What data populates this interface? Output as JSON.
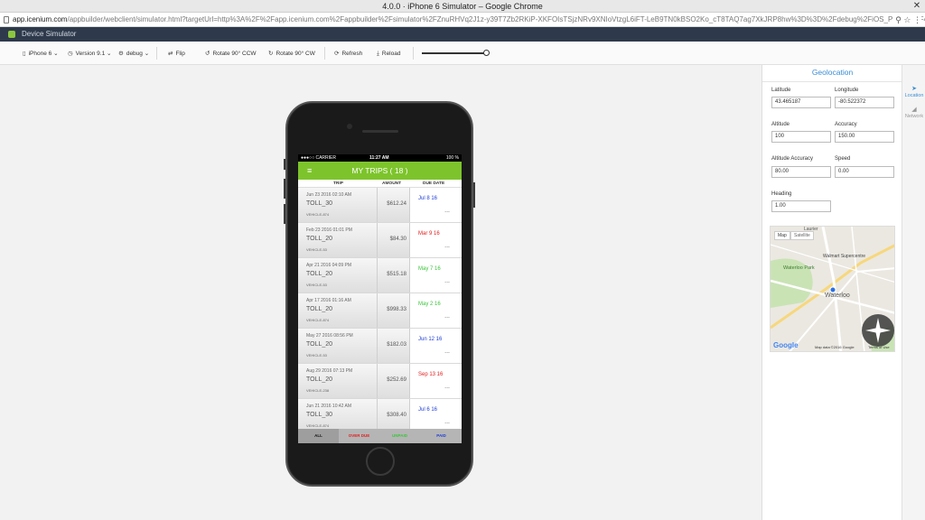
{
  "window": {
    "title": "4.0.0 · iPhone 6 Simulator – Google Chrome"
  },
  "url": {
    "host": "app.icenium.com",
    "path": "/appbuilder/webclient/simulator.html?targetUrl=http%3A%2F%2Fapp.icenium.com%2Fappbuilder%2Fsimulator%2FZnuRHVq2J1z-y39T7Zb2RKiP-XKFOIsTSjzNRv9XNIoVtzgL6iFT-LeB9TN0kBSO2Ko_cT8TAQ7ag7XkJRP8hw%3D%3D%2Fdebug%2FiOS_Phone%2F4.0.0%2Findex.html"
  },
  "app": {
    "name": "Device Simulator"
  },
  "toolbar": {
    "device": "iPhone 6",
    "version": "Version 9.1",
    "config": "debug",
    "flip": "Flip",
    "rotate_ccw": "Rotate 90° CCW",
    "rotate_cw": "Rotate 90° CW",
    "refresh": "Refresh",
    "reload": "Reload",
    "zoom_level": 1.0
  },
  "phone": {
    "status": {
      "carrier": "●●●○○ CARRIER",
      "time": "11:27 AM",
      "battery": "100 %"
    },
    "title": "MY TRIPS ( 18 )",
    "columns": {
      "trip": "TRIP",
      "amount": "AMOUNT",
      "due": "DUE DATE"
    },
    "rows": [
      {
        "date": "Jun 23 2016 02:10 AM",
        "trip": "TOLL_30",
        "vehicle": "VEHICLE-874",
        "amount": "$612.24",
        "due": "Jul 8 16",
        "due_color": "#1f3fd6"
      },
      {
        "date": "Feb 23 2016 01:01 PM",
        "trip": "TOLL_20",
        "vehicle": "VEHICLE-53",
        "amount": "$84.30",
        "due": "Mar 9 16",
        "due_color": "#e02020"
      },
      {
        "date": "Apr 21 2016 04:09 PM",
        "trip": "TOLL_20",
        "vehicle": "VEHICLE-53",
        "amount": "$515.18",
        "due": "May 7 16",
        "due_color": "#3cc43c"
      },
      {
        "date": "Apr 17 2016 01:16 AM",
        "trip": "TOLL_20",
        "vehicle": "VEHICLE-874",
        "amount": "$998.33",
        "due": "May 2 16",
        "due_color": "#3cc43c"
      },
      {
        "date": "May 27 2016 08:56 PM",
        "trip": "TOLL_20",
        "vehicle": "VEHICLE-53",
        "amount": "$182.03",
        "due": "Jun 12 16",
        "due_color": "#1f3fd6"
      },
      {
        "date": "Aug 29 2016 07:13 PM",
        "trip": "TOLL_20",
        "vehicle": "VEHICLE-238",
        "amount": "$252.69",
        "due": "Sep 13 16",
        "due_color": "#e02020"
      },
      {
        "date": "Jun 21 2016 10:42 AM",
        "trip": "TOLL_30",
        "vehicle": "VEHICLE-874",
        "amount": "$308.40",
        "due": "Jul 6 16",
        "due_color": "#1f3fd6"
      }
    ],
    "more": "...",
    "tabs": [
      {
        "label": "ALL",
        "color": "#111111"
      },
      {
        "label": "OVER DUE",
        "color": "#e02020"
      },
      {
        "label": "UNPAID",
        "color": "#3cc43c"
      },
      {
        "label": "PAID",
        "color": "#1f3fd6"
      }
    ],
    "accent": "#7dc42c"
  },
  "geolocation": {
    "title": "Geolocation",
    "latitude": {
      "label": "Latitude",
      "value": "43.465187"
    },
    "longitude": {
      "label": "Longitude",
      "value": "-80.522372"
    },
    "altitude": {
      "label": "Altitude",
      "value": "100"
    },
    "accuracy": {
      "label": "Accuracy",
      "value": "150.00"
    },
    "altitude_accuracy": {
      "label": "Altitude Accuracy",
      "value": "80.00"
    },
    "speed": {
      "label": "Speed",
      "value": "0.00"
    },
    "heading": {
      "label": "Heading",
      "value": "1.00"
    },
    "map": {
      "tab_map": "Map",
      "tab_satellite": "Satellite",
      "labels": [
        "Laurier",
        "Walmart Supercentre",
        "Waterloo Park",
        "Waterloo"
      ],
      "brand": "Google",
      "attribution": "Map data ©2016 Google",
      "terms": "Terms of Use"
    }
  },
  "rail": {
    "location": "Location",
    "network": "Network"
  }
}
